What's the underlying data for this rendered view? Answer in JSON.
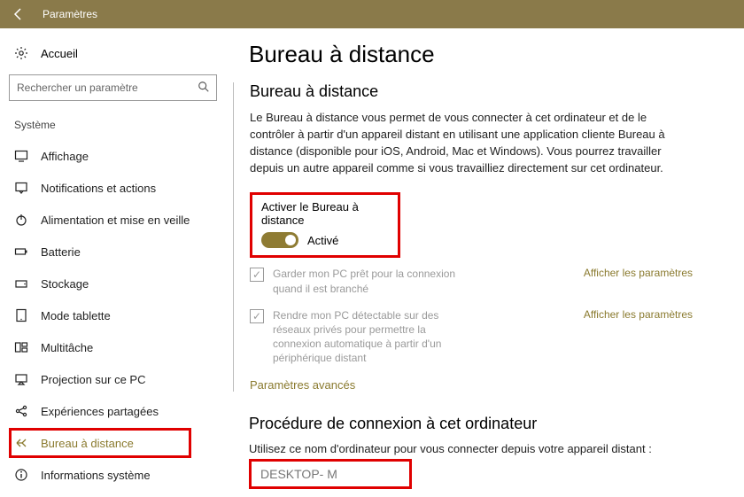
{
  "titlebar": {
    "title": "Paramètres"
  },
  "sidebar": {
    "home": "Accueil",
    "search_placeholder": "Rechercher un paramètre",
    "group": "Système",
    "items": [
      {
        "label": "Affichage"
      },
      {
        "label": "Notifications et actions"
      },
      {
        "label": "Alimentation et mise en veille"
      },
      {
        "label": "Batterie"
      },
      {
        "label": "Stockage"
      },
      {
        "label": "Mode tablette"
      },
      {
        "label": "Multitâche"
      },
      {
        "label": "Projection sur ce PC"
      },
      {
        "label": "Expériences partagées"
      },
      {
        "label": "Bureau à distance"
      },
      {
        "label": "Informations système"
      }
    ]
  },
  "main": {
    "title": "Bureau à distance",
    "section": "Bureau à distance",
    "description": "Le Bureau à distance vous permet de vous connecter à cet ordinateur et de le contrôler à partir d'un appareil distant en utilisant une application cliente Bureau à distance (disponible pour iOS, Android, Mac et Windows). Vous pourrez travailler depuis un autre appareil comme si vous travailliez directement sur cet ordinateur.",
    "toggle_label": "Activer le Bureau à distance",
    "toggle_state": "Activé",
    "check1": "Garder mon PC prêt pour la connexion quand il est branché",
    "check2": "Rendre mon PC détectable sur des réseaux privés pour permettre la connexion automatique à partir d'un périphérique distant",
    "show_params": "Afficher les paramètres",
    "advanced": "Paramètres avancés",
    "proc_title": "Procédure de connexion à cet ordinateur",
    "proc_text": "Utilisez ce nom d'ordinateur pour vous connecter depuis votre appareil distant :",
    "pc_name": "DESKTOP-          M"
  }
}
